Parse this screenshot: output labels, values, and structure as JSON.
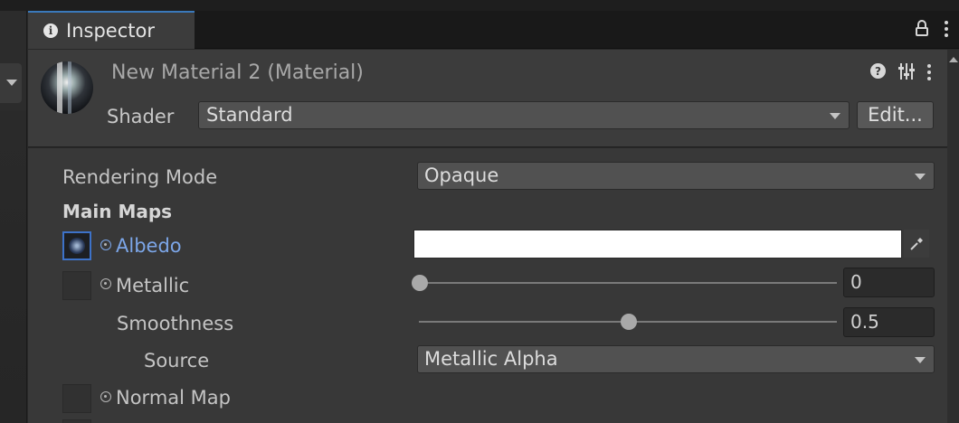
{
  "window": {
    "tab_label": "Inspector",
    "tab_icon": "info-icon",
    "tab_actions": [
      "lock-icon",
      "kebab-menu-icon"
    ]
  },
  "header": {
    "title": "New Material 2 (Material)",
    "shader_label": "Shader",
    "shader_value": "Standard",
    "edit_label": "Edit...",
    "icons": [
      "help-icon",
      "preset-settings-icon",
      "kebab-menu-icon"
    ]
  },
  "properties": {
    "rendering_mode": {
      "label": "Rendering Mode",
      "value": "Opaque"
    },
    "main_maps_heading": "Main Maps",
    "albedo": {
      "label": "Albedo",
      "color": "#ffffff"
    },
    "metallic": {
      "label": "Metallic",
      "value": "0",
      "fraction": 0.0
    },
    "smoothness": {
      "label": "Smoothness",
      "value": "0.5",
      "fraction": 0.5
    },
    "source": {
      "label": "Source",
      "value": "Metallic Alpha"
    },
    "normal_map": {
      "label": "Normal Map"
    }
  },
  "colors": {
    "accent": "#3a79bb",
    "albedo_label": "#7ca6e8",
    "panel": "#383838",
    "header": "#3c3c3c"
  }
}
